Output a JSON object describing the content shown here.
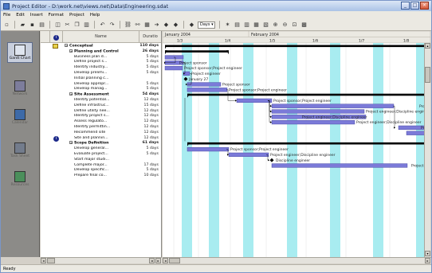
{
  "window": {
    "title": "Project Editor - D:\\work.net\\views.net\\Data\\Engineering.sdat",
    "controls": [
      "_",
      "□",
      "×"
    ]
  },
  "menu": [
    "File",
    "Edit",
    "Insert",
    "Format",
    "Project",
    "Help"
  ],
  "toolbar": {
    "zoom_label": "Days",
    "buttons": [
      "new-icon",
      "open-icon",
      "save-icon",
      "print-icon",
      "preview-icon",
      "cut-icon",
      "copy-icon",
      "paste-icon",
      "undo-icon",
      "redo-icon",
      "link-icon",
      "unlink-icon",
      "task-info-icon",
      "indent-icon",
      "outdent-icon",
      "show-icon",
      "hide-icon",
      "scroll-to-task-icon",
      "align-left-icon",
      "align-center-icon",
      "align-right-icon",
      "justify-icon",
      "zoom-in-icon",
      "zoom-out-icon",
      "zoom-fit-icon",
      "calendar-icon"
    ]
  },
  "views": [
    {
      "name": "gantt-chart-view",
      "label": "Gantt Chart",
      "active": true,
      "color": "#5b6f9f"
    },
    {
      "name": "network-view",
      "label": "Network",
      "active": false,
      "color": "#7d7d9c"
    },
    {
      "name": "calendar-view",
      "label": "Calendar",
      "active": false,
      "color": "#3d6aa8"
    },
    {
      "name": "task-sheet-view",
      "label": "Task Sheet",
      "active": false,
      "color": "#737c8c"
    },
    {
      "name": "resource-view",
      "label": "Resources",
      "active": false,
      "color": "#4b8f5b"
    }
  ],
  "grid": {
    "columns": {
      "info": "i",
      "name": "Name",
      "duration": "Duratio"
    },
    "rows": [
      {
        "level": 0,
        "name": "Conceptual",
        "duration": "110 days",
        "summary": true,
        "note": true
      },
      {
        "level": 1,
        "name": "Planning and Control",
        "duration": "26 days",
        "summary": true
      },
      {
        "level": 2,
        "name": "Business plan d...",
        "duration": "5 days"
      },
      {
        "level": 2,
        "name": "Define project s...",
        "duration": "5 days"
      },
      {
        "level": 2,
        "name": "Identify industry...",
        "duration": "5 days"
      },
      {
        "level": 2,
        "name": "Develop prelimi...",
        "duration": "5 days"
      },
      {
        "level": 2,
        "name": "Initial planning c...",
        "duration": ""
      },
      {
        "level": 2,
        "name": "Develop appropr...",
        "duration": "5 days"
      },
      {
        "level": 2,
        "name": "Develop manag...",
        "duration": "5 days"
      },
      {
        "level": 1,
        "name": "Site Assessment",
        "duration": "54 days",
        "summary": true
      },
      {
        "level": 2,
        "name": "Identify potential...",
        "duration": "12 days"
      },
      {
        "level": 2,
        "name": "Define infrastruc...",
        "duration": "15 days"
      },
      {
        "level": 2,
        "name": "Define utility nee...",
        "duration": "12 days"
      },
      {
        "level": 2,
        "name": "Identify project s...",
        "duration": "12 days"
      },
      {
        "level": 2,
        "name": "Assess regulato...",
        "duration": "12 days"
      },
      {
        "level": 2,
        "name": "Identify permittin...",
        "duration": "12 days"
      },
      {
        "level": 2,
        "name": "Recommend site",
        "duration": "12 days"
      },
      {
        "level": 2,
        "name": "Site and plannin...",
        "duration": "12 days",
        "indicator": true
      },
      {
        "level": 1,
        "name": "Scope Definition",
        "duration": "61 days",
        "summary": true
      },
      {
        "level": 2,
        "name": "Develop general...",
        "duration": "5 days"
      },
      {
        "level": 2,
        "name": "Evaluate project...",
        "duration": "5 days"
      },
      {
        "level": 2,
        "name": "Start major studi...",
        "duration": ""
      },
      {
        "level": 2,
        "name": "Complete major...",
        "duration": "17 days"
      },
      {
        "level": 2,
        "name": "Develop specific...",
        "duration": "5 days"
      },
      {
        "level": 2,
        "name": "Prepare final co...",
        "duration": "10 days"
      }
    ]
  },
  "timescale": {
    "major": [
      "January 2004",
      "February 2004"
    ],
    "minor": [
      "1/3",
      "1/4",
      "1/5",
      "1/6",
      "1/7",
      "1/8"
    ]
  },
  "chart": {
    "labels": {
      "pe": "Project engineer",
      "ps": "Project sponsor",
      "ps_pe": "Project sponsor;Project engineer",
      "pe_de": "Project engineer;Discipline engineer",
      "de": "Discipline engineer",
      "milestone": "January 27"
    },
    "colors": {
      "bar": "#7b7ad8",
      "bar_border": "#3b3a98",
      "weekend": "#a8ecf0",
      "summary": "#000000"
    }
  },
  "status": "Ready"
}
